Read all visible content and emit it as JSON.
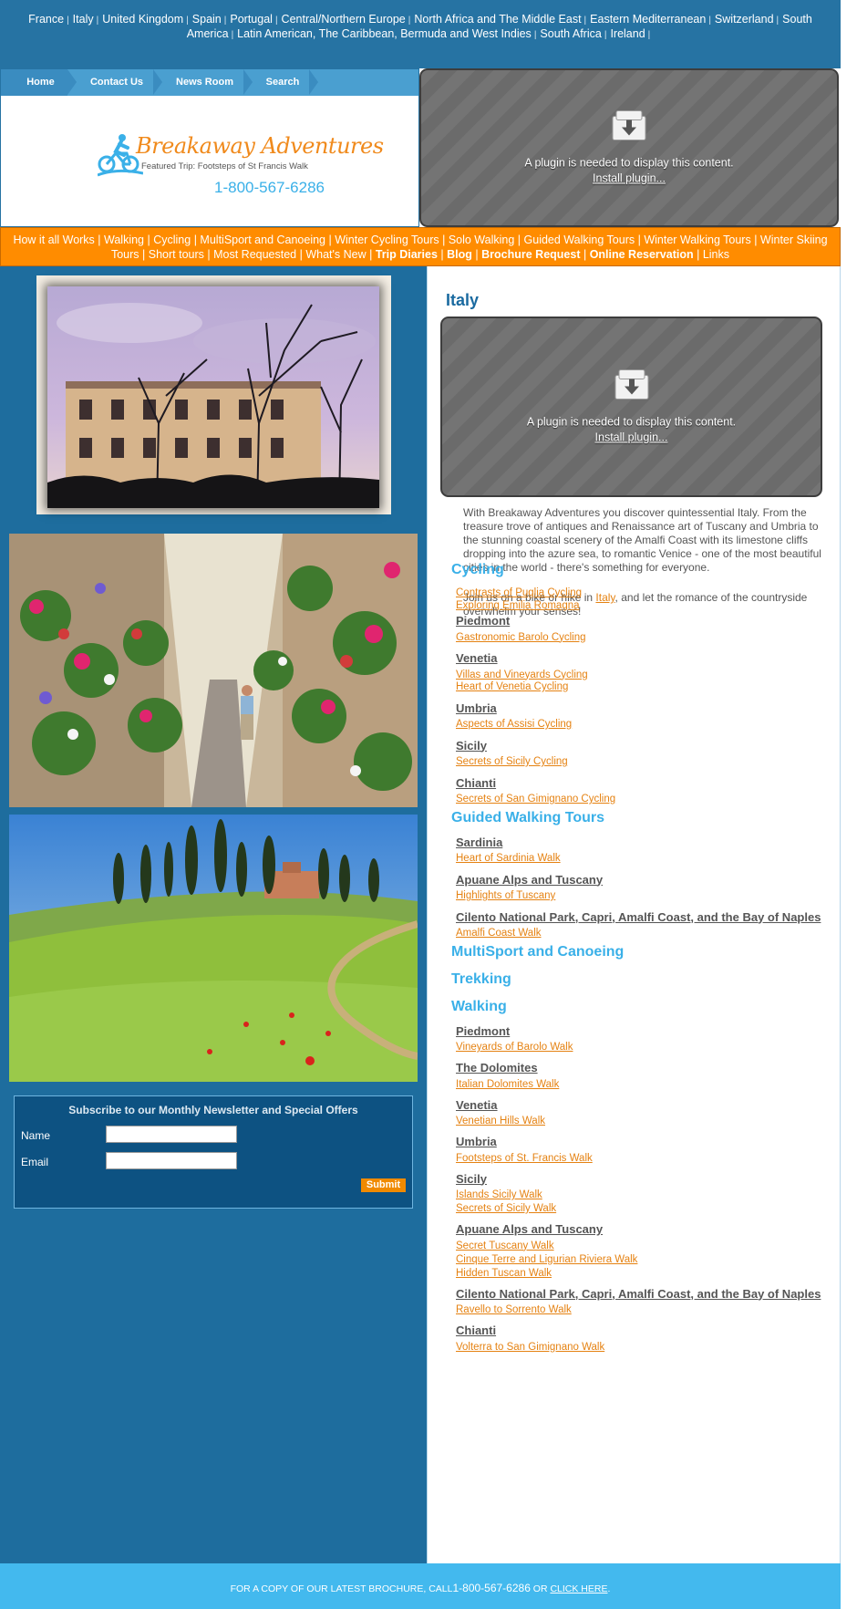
{
  "countries": [
    "France",
    "Italy",
    "United Kingdom",
    "Spain",
    "Portugal",
    "Central/Northern Europe",
    "North Africa and The Middle East",
    "Eastern Mediterranean",
    "Switzerland",
    "South America",
    "Latin American, The Caribbean, Bermuda and West Indies",
    "South Africa",
    "Ireland"
  ],
  "nav": {
    "home": "Home",
    "contact": "Contact Us",
    "news": "News Room",
    "search": "Search"
  },
  "logo": {
    "title": "Breakaway Adventures",
    "tagline": "Featured Trip: Footsteps of St Francis Walk",
    "phone": "1-800-567-6286"
  },
  "plugin": {
    "message": "A plugin is needed to display this content.",
    "install": "Install plugin..."
  },
  "categories": [
    {
      "label": "How it all Works",
      "bold": false
    },
    {
      "label": "Walking",
      "bold": false
    },
    {
      "label": "Cycling",
      "bold": false
    },
    {
      "label": "MultiSport and Canoeing",
      "bold": false
    },
    {
      "label": "Winter Cycling Tours",
      "bold": false
    },
    {
      "label": "Solo Walking",
      "bold": false
    },
    {
      "label": "Guided Walking Tours",
      "bold": false
    },
    {
      "label": "Winter Walking Tours",
      "bold": false
    },
    {
      "label": "Winter Skiing Tours",
      "bold": false
    },
    {
      "label": "Short tours",
      "bold": false
    },
    {
      "label": "Most Requested",
      "bold": false
    },
    {
      "label": "What's New",
      "bold": false
    },
    {
      "label": "Trip Diaries",
      "bold": true
    },
    {
      "label": "Blog",
      "bold": true
    },
    {
      "label": "Brochure Request",
      "bold": true
    },
    {
      "label": "Online Reservation",
      "bold": true
    },
    {
      "label": "Links",
      "bold": false
    }
  ],
  "newsletter": {
    "title": "Subscribe to our Monthly Newsletter and Special Offers",
    "name_label": "Name",
    "email_label": "Email",
    "submit": "Submit"
  },
  "main": {
    "title": "Italy",
    "intro1": "With Breakaway Adventures you discover quintessential Italy. From the treasure trove of antiques and Renaissance art of Tuscany and Umbria to the stunning coastal scenery of the Amalfi Coast with its limestone cliffs dropping into the azure sea, to romantic Venice - one of the most beautiful cities in the world - there's something for everyone.",
    "intro2_before": "Join us on a bike or hike in ",
    "intro2_link": "Italy",
    "intro2_after": ", and let the romance of the countryside overwhelm your senses!",
    "sections": {
      "cycling": "Cycling",
      "guided": "Guided Walking Tours",
      "multisport": "MultiSport and Canoeing",
      "trekking": "Trekking",
      "walking": "Walking"
    },
    "cycling": {
      "general": [
        "Contrasts of Puglia Cycling",
        "Exploring Emilia Romagna"
      ],
      "regions": [
        {
          "name": "Piedmont",
          "trips": [
            "Gastronomic Barolo Cycling"
          ]
        },
        {
          "name": "Venetia",
          "trips": [
            "Villas and Vineyards Cycling",
            "Heart of Venetia Cycling"
          ]
        },
        {
          "name": "Umbria",
          "trips": [
            "Aspects of Assisi Cycling"
          ]
        },
        {
          "name": "Sicily",
          "trips": [
            "Secrets of Sicily Cycling"
          ]
        },
        {
          "name": "Chianti",
          "trips": [
            "Secrets of San Gimignano Cycling"
          ]
        }
      ]
    },
    "guided": {
      "regions": [
        {
          "name": "Sardinia",
          "trips": [
            "Heart of Sardinia Walk"
          ]
        },
        {
          "name": "Apuane Alps and Tuscany",
          "trips": [
            "Highlights of Tuscany"
          ]
        },
        {
          "name": "Cilento National Park, Capri, Amalfi Coast, and the Bay of Naples",
          "trips": [
            "Amalfi Coast Walk"
          ]
        }
      ]
    },
    "walking": {
      "regions": [
        {
          "name": "Piedmont",
          "trips": [
            "Vineyards of Barolo Walk"
          ]
        },
        {
          "name": "The Dolomites",
          "trips": [
            "Italian Dolomites Walk"
          ]
        },
        {
          "name": "Venetia",
          "trips": [
            "Venetian Hills Walk"
          ]
        },
        {
          "name": "Umbria",
          "trips": [
            "Footsteps of St. Francis Walk"
          ]
        },
        {
          "name": "Sicily",
          "trips": [
            "Islands Sicily Walk",
            "Secrets of Sicily Walk"
          ]
        },
        {
          "name": "Apuane Alps and Tuscany",
          "trips": [
            "Secret Tuscany Walk",
            "Cinque Terre and Ligurian Riviera Walk",
            "Hidden Tuscan Walk"
          ]
        },
        {
          "name": "Cilento National Park, Capri, Amalfi Coast, and the Bay of Naples",
          "trips": [
            "Ravello to Sorrento Walk"
          ]
        },
        {
          "name": "Chianti",
          "trips": [
            "Volterra to San Gimignano Walk"
          ]
        }
      ]
    }
  },
  "footer": {
    "prefix": "FOR A COPY OF OUR LATEST BROCHURE, CALL",
    "phone": "1-800-567-6286",
    "middle": " OR ",
    "link": "CLICK HERE",
    "suffix": "."
  },
  "colors": {
    "blue_bar": "#2673a3",
    "orange_bar": "#ff8c00",
    "accent_blue": "#3ab0e8",
    "link_orange": "#e58212",
    "footer": "#43b9ee"
  }
}
